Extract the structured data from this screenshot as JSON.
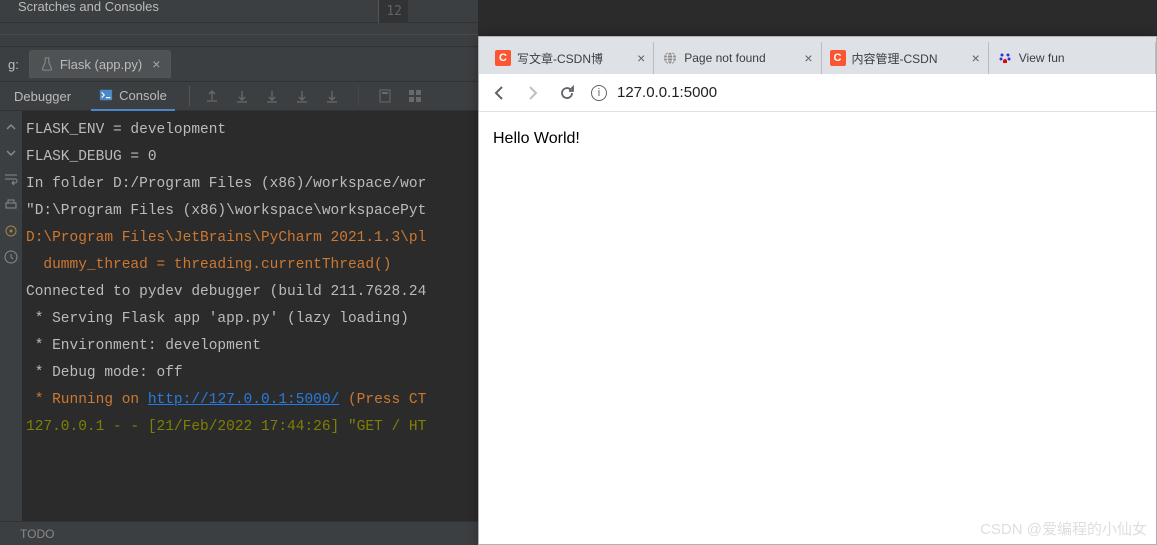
{
  "ide": {
    "scratches": "Scratches and Consoles",
    "gutter_line": "12",
    "run_label": "g:",
    "run_tab": "Flask (app.py)",
    "debugger_tab": "Debugger",
    "console_tab": "Console",
    "console_lines": {
      "l1": "FLASK_ENV = development",
      "l2": "FLASK_DEBUG = 0",
      "l3": "In folder D:/Program Files (x86)/workspace/wor",
      "l4": "\"D:\\Program Files (x86)\\workspace\\workspacePyt",
      "l5": "D:\\Program Files\\JetBrains\\PyCharm 2021.1.3\\pl",
      "l6": "  dummy_thread = threading.currentThread()",
      "l7": "Connected to pydev debugger (build 211.7628.24",
      "l8": " * Serving Flask app 'app.py' (lazy loading)",
      "l9": " * Environment: development",
      "l10": " * Debug mode: off",
      "l11a": " * Running on ",
      "l11b": "http://127.0.0.1:5000/",
      "l11c": " (Press CT",
      "l12": "127.0.0.1 - - [21/Feb/2022 17:44:26] \"GET / HT"
    },
    "bottom": {
      "todo": "TODO"
    }
  },
  "browser": {
    "tabs": [
      {
        "favicon": "csdn",
        "label": "写文章-CSDN博"
      },
      {
        "favicon": "globe",
        "label": "Page not found"
      },
      {
        "favicon": "csdn",
        "label": "内容管理-CSDN"
      },
      {
        "favicon": "baidu",
        "label": "View fun"
      }
    ],
    "url": "127.0.0.1:5000",
    "page_text": "Hello World!"
  },
  "watermark": "CSDN @爱编程的小仙女"
}
